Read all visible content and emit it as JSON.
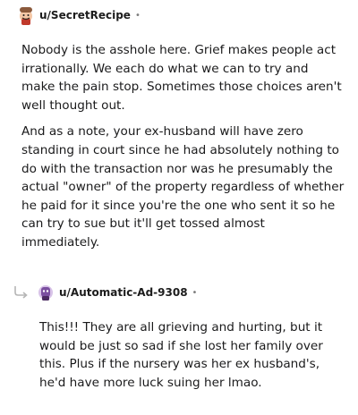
{
  "comments": [
    {
      "username": "u/SecretRecipe",
      "separator": "•",
      "paragraphs": [
        "Nobody is the asshole here. Grief makes people act irrationally. We each do what we can to try and make the pain stop. Sometimes those choices aren't well thought out.",
        "And as a note, your ex-husband will have zero standing in court since he had absolutely nothing to do with the transaction nor was he presumably the actual \"owner\" of the property regardless of whether he paid for it since you're the one who sent it so he can try to sue but it'll get tossed almost immediately."
      ]
    },
    {
      "username": "u/Automatic-Ad-9308",
      "separator": "•",
      "paragraphs": [
        "This!!! They are all grieving and hurting, but it would be just so sad if she lost her family over this. Plus if the nursery was her ex husband's, he'd have more luck suing her lmao."
      ]
    }
  ]
}
